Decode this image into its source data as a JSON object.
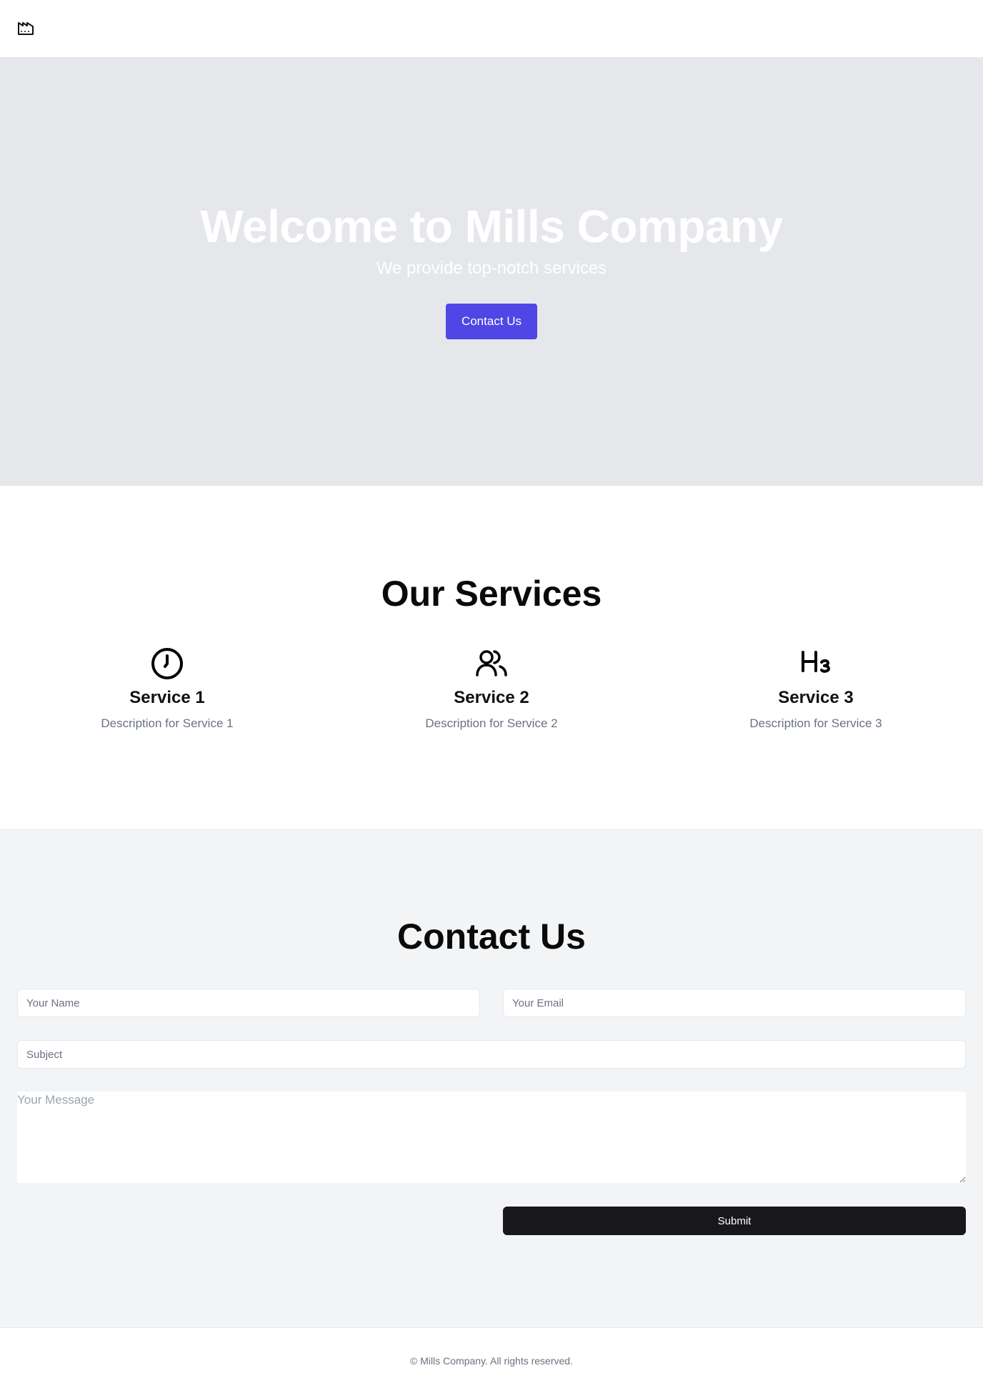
{
  "header": {
    "logo_icon": "factory-icon"
  },
  "hero": {
    "title": "Welcome to Mills Company",
    "subtitle": "We provide top-notch services",
    "cta_label": "Contact Us",
    "background": "#e5e7eb",
    "accent": "#4f46e5"
  },
  "services": {
    "heading": "Our Services",
    "items": [
      {
        "icon": "clock-icon",
        "name": "Service 1",
        "description": "Description for Service 1"
      },
      {
        "icon": "users-icon",
        "name": "Service 2",
        "description": "Description for Service 2"
      },
      {
        "icon": "heading-3-icon",
        "name": "Service 3",
        "description": "Description for Service 3"
      }
    ]
  },
  "contact": {
    "heading": "Contact Us",
    "name_placeholder": "Your Name",
    "email_placeholder": "Your Email",
    "subject_placeholder": "Subject",
    "message_placeholder": "Your Message",
    "submit_label": "Submit",
    "background": "#f3f4f6"
  },
  "footer": {
    "text": "© Mills Company. All rights reserved."
  }
}
